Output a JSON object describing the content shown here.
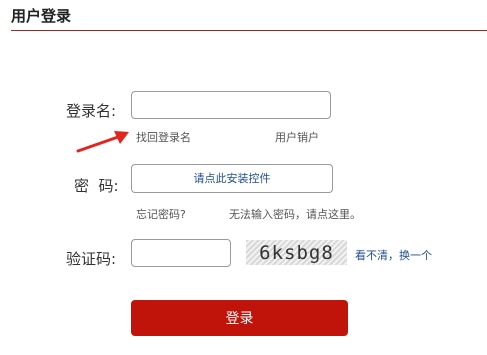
{
  "header": {
    "title": "用户登录"
  },
  "form": {
    "username_label": "登录名:",
    "password_label": "密  码:",
    "captcha_label": "验证码:",
    "username_value": "",
    "captcha_value": "",
    "install_control_label": "请点此安装控件",
    "find_login_name": "找回登录名",
    "cancel_account": "用户销户",
    "forgot_password": "忘记密码?",
    "cannot_input_password": "无法输入密码，请点这里。",
    "captcha_text": "6ksbg8",
    "refresh_captcha": "看不清，换一个",
    "submit_label": "登录"
  },
  "colors": {
    "accent": "#c0140b",
    "header_line": "#9b2b24",
    "link": "#1f4f91"
  },
  "annotations": {
    "arrow": "red-arrow-pointing-to-find-login-name"
  }
}
